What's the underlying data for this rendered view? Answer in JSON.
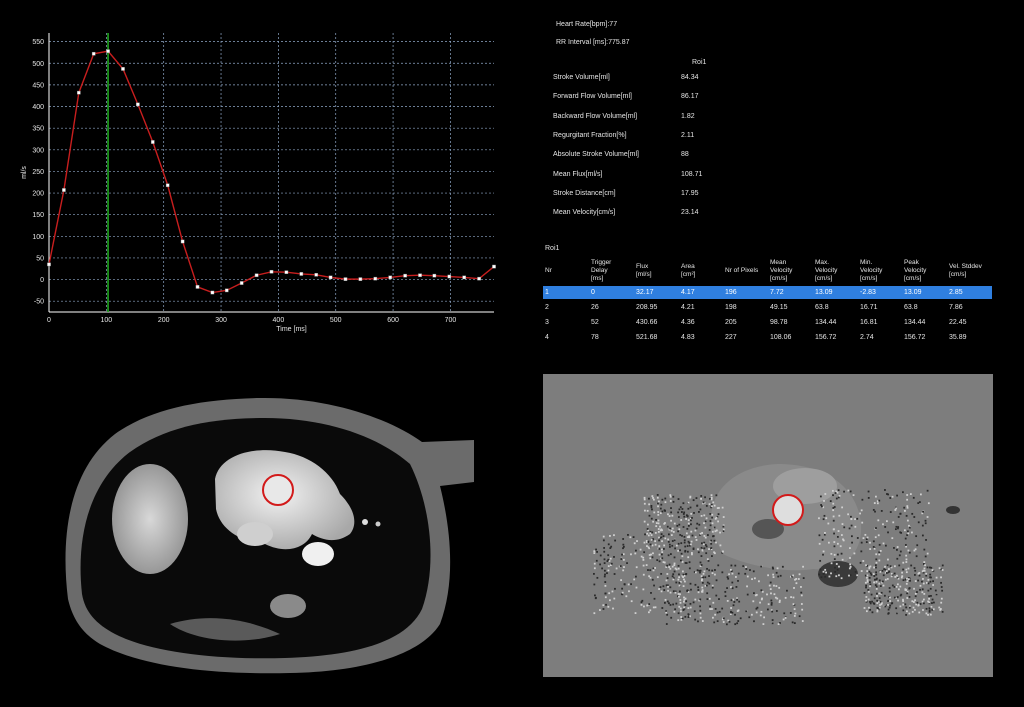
{
  "info": {
    "heart_rate": "Heart Rate[bpm]:77",
    "rr_interval": "RR Interval [ms]:775.87"
  },
  "stats": {
    "roi_header": "Roi1",
    "rows": [
      {
        "label": "Stroke Volume[ml]",
        "value": "84.34"
      },
      {
        "label": "Forward Flow Volume[ml]",
        "value": "86.17"
      },
      {
        "label": "Backward Flow Volume[ml]",
        "value": "1.82"
      },
      {
        "label": "Regurgitant Fraction[%]",
        "value": "2.11"
      },
      {
        "label": "Absolute Stroke Volume[ml]",
        "value": "88"
      },
      {
        "label": "Mean Flux[ml/s]",
        "value": "108.71"
      },
      {
        "label": "Stroke Distance[cm]",
        "value": "17.95"
      },
      {
        "label": "Mean Velocity[cm/s]",
        "value": "23.14"
      }
    ]
  },
  "table": {
    "roi_label": "Roi1",
    "columns": [
      {
        "l1": "Nr",
        "l2": "",
        "l3": ""
      },
      {
        "l1": "Trigger",
        "l2": "Delay",
        "l3": "[ms]"
      },
      {
        "l1": "Flux",
        "l2": "[ml/s]",
        "l3": ""
      },
      {
        "l1": "Area",
        "l2": "[cm²]",
        "l3": ""
      },
      {
        "l1": "Nr of Pixels",
        "l2": "",
        "l3": ""
      },
      {
        "l1": "Mean",
        "l2": "Velocity",
        "l3": "[cm/s]"
      },
      {
        "l1": "Max.",
        "l2": "Velocity",
        "l3": "[cm/s]"
      },
      {
        "l1": "Min.",
        "l2": "Velocity",
        "l3": "[cm/s]"
      },
      {
        "l1": "Peak",
        "l2": "Velocity",
        "l3": "[cm/s]"
      },
      {
        "l1": "Vel. Stddev",
        "l2": "[cm/s]",
        "l3": ""
      }
    ],
    "rows": [
      [
        "1",
        "0",
        "32.17",
        "4.17",
        "196",
        "7.72",
        "13.09",
        "-2.83",
        "13.09",
        "2.85"
      ],
      [
        "2",
        "26",
        "208.95",
        "4.21",
        "198",
        "49.15",
        "63.8",
        "16.71",
        "63.8",
        "7.86"
      ],
      [
        "3",
        "52",
        "430.66",
        "4.36",
        "205",
        "98.78",
        "134.44",
        "16.81",
        "134.44",
        "22.45"
      ],
      [
        "4",
        "78",
        "521.68",
        "4.83",
        "227",
        "108.06",
        "156.72",
        "2.74",
        "156.72",
        "35.89"
      ]
    ],
    "selected_row": 0
  },
  "chart_data": {
    "type": "line",
    "xlabel": "Time [ms]",
    "ylabel": "ml/s",
    "xlim": [
      0,
      776
    ],
    "ylim": [
      -75,
      570
    ],
    "xticks": [
      0,
      100,
      200,
      300,
      400,
      500,
      600,
      700
    ],
    "yticks": [
      -50,
      0,
      50,
      100,
      150,
      200,
      250,
      300,
      350,
      400,
      450,
      500,
      550
    ],
    "grid": true,
    "cursor_x": 103,
    "colors": {
      "line": "#c81e1e",
      "cursor": "#1fa51f",
      "grid": "#8fa8c8",
      "markers": "#ffffff"
    },
    "x": [
      0,
      26,
      52,
      78,
      103,
      129,
      155,
      181,
      207,
      233,
      259,
      285,
      310,
      336,
      362,
      388,
      414,
      440,
      466,
      491,
      517,
      543,
      569,
      595,
      621,
      647,
      672,
      698,
      724,
      750,
      776
    ],
    "values": [
      35,
      207,
      432,
      522,
      528,
      487,
      405,
      318,
      218,
      88,
      -17,
      -30,
      -25,
      -8,
      10,
      18,
      17,
      13,
      11,
      5,
      1,
      1,
      2,
      5,
      9,
      10,
      9,
      7,
      5,
      2,
      30
    ]
  },
  "images": {
    "magnitude": {
      "icon": "mri-magnitude-image"
    },
    "phase": {
      "icon": "mri-phase-image"
    }
  }
}
